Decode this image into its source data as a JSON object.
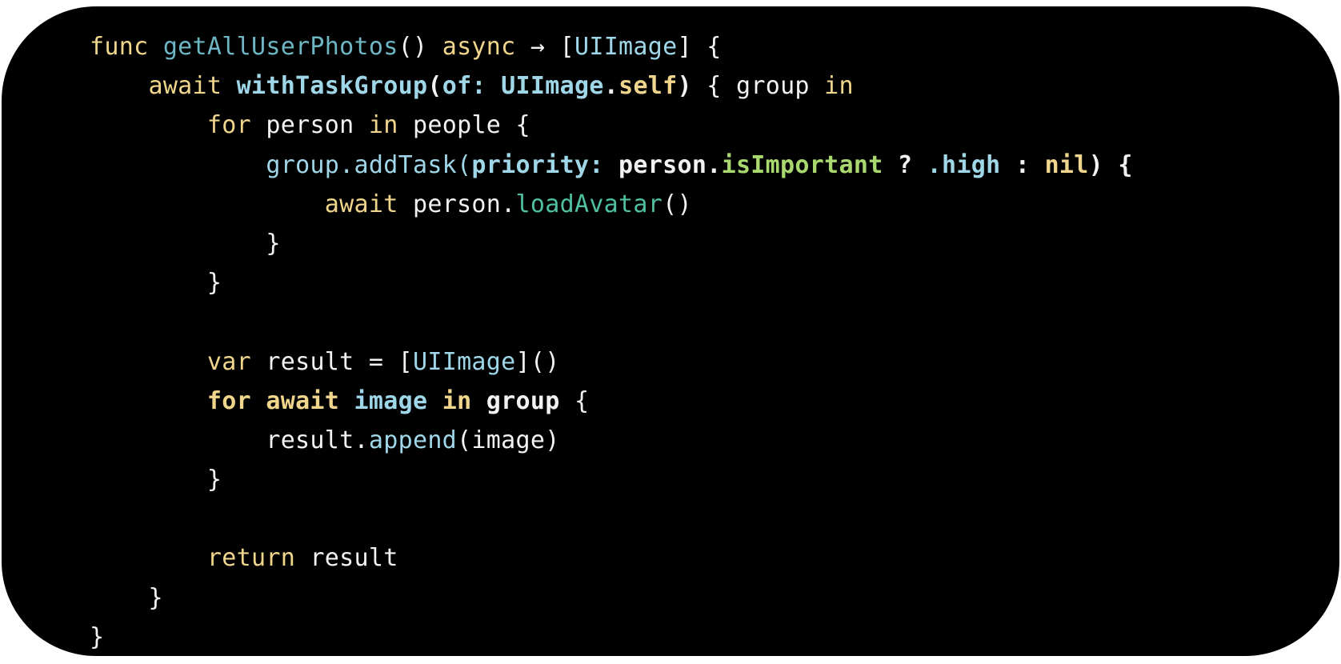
{
  "colors": {
    "background": "#000000",
    "page": "#ffffff",
    "default": "#f2f2f2",
    "keyword": "#f0d58c",
    "function": "#6fb6c4",
    "type": "#9fd6e8",
    "method_green": "#4fc0a0",
    "bright_green": "#a8d86e"
  },
  "code": {
    "language": "swift",
    "lines": [
      {
        "tokens": [
          {
            "text": "func ",
            "role": "keyword"
          },
          {
            "text": "getAllUserPhotos",
            "role": "function"
          },
          {
            "text": "() ",
            "role": "default"
          },
          {
            "text": "async",
            "role": "keyword"
          },
          {
            "text": " → [",
            "role": "default"
          },
          {
            "text": "UIImage",
            "role": "type"
          },
          {
            "text": "] {",
            "role": "default"
          }
        ]
      },
      {
        "tokens": [
          {
            "text": "    ",
            "role": "default"
          },
          {
            "text": "await ",
            "role": "keyword"
          },
          {
            "text": "withTaskGroup",
            "role": "type",
            "bold": true
          },
          {
            "text": "(",
            "role": "default",
            "bold": true
          },
          {
            "text": "of:",
            "role": "type",
            "bold": true
          },
          {
            "text": " ",
            "role": "default"
          },
          {
            "text": "UIImage",
            "role": "type",
            "bold": true
          },
          {
            "text": ".",
            "role": "default",
            "bold": true
          },
          {
            "text": "self",
            "role": "keyword",
            "bold": true
          },
          {
            "text": ")",
            "role": "default",
            "bold": true
          },
          {
            "text": " { group ",
            "role": "default"
          },
          {
            "text": "in",
            "role": "keyword"
          }
        ]
      },
      {
        "tokens": [
          {
            "text": "        ",
            "role": "default"
          },
          {
            "text": "for",
            "role": "keyword"
          },
          {
            "text": " person ",
            "role": "default"
          },
          {
            "text": "in",
            "role": "keyword"
          },
          {
            "text": " people {",
            "role": "default"
          }
        ]
      },
      {
        "tokens": [
          {
            "text": "            ",
            "role": "default"
          },
          {
            "text": "group.addTask(",
            "role": "type"
          },
          {
            "text": "priority:",
            "role": "type",
            "bold": true
          },
          {
            "text": " person.",
            "role": "default",
            "bold": true
          },
          {
            "text": "isImportant",
            "role": "bright_green",
            "bold": true
          },
          {
            "text": " ? ",
            "role": "default",
            "bold": true
          },
          {
            "text": ".high",
            "role": "type",
            "bold": true
          },
          {
            "text": " : ",
            "role": "default",
            "bold": true
          },
          {
            "text": "nil",
            "role": "keyword",
            "bold": true
          },
          {
            "text": ") {",
            "role": "default",
            "bold": true
          }
        ]
      },
      {
        "tokens": [
          {
            "text": "                ",
            "role": "default"
          },
          {
            "text": "await",
            "role": "keyword"
          },
          {
            "text": " person.",
            "role": "default"
          },
          {
            "text": "loadAvatar",
            "role": "method_green"
          },
          {
            "text": "()",
            "role": "default"
          }
        ]
      },
      {
        "tokens": [
          {
            "text": "            }",
            "role": "default"
          }
        ]
      },
      {
        "tokens": [
          {
            "text": "        }",
            "role": "default"
          }
        ]
      },
      {
        "tokens": [
          {
            "text": "",
            "role": "default"
          }
        ]
      },
      {
        "tokens": [
          {
            "text": "        ",
            "role": "default"
          },
          {
            "text": "var",
            "role": "keyword"
          },
          {
            "text": " result = [",
            "role": "default"
          },
          {
            "text": "UIImage",
            "role": "type"
          },
          {
            "text": "]()",
            "role": "default"
          }
        ]
      },
      {
        "tokens": [
          {
            "text": "        ",
            "role": "default"
          },
          {
            "text": "for await ",
            "role": "keyword",
            "bold": true
          },
          {
            "text": "image ",
            "role": "type",
            "bold": true
          },
          {
            "text": "in ",
            "role": "keyword",
            "bold": true
          },
          {
            "text": "group ",
            "role": "default",
            "bold": true
          },
          {
            "text": "{",
            "role": "default"
          }
        ]
      },
      {
        "tokens": [
          {
            "text": "            result.",
            "role": "default"
          },
          {
            "text": "append",
            "role": "type"
          },
          {
            "text": "(image)",
            "role": "default"
          }
        ]
      },
      {
        "tokens": [
          {
            "text": "        }",
            "role": "default"
          }
        ]
      },
      {
        "tokens": [
          {
            "text": "",
            "role": "default"
          }
        ]
      },
      {
        "tokens": [
          {
            "text": "        ",
            "role": "default"
          },
          {
            "text": "return",
            "role": "keyword"
          },
          {
            "text": " result",
            "role": "default"
          }
        ]
      },
      {
        "tokens": [
          {
            "text": "    }",
            "role": "default"
          }
        ]
      },
      {
        "tokens": [
          {
            "text": "}",
            "role": "default"
          }
        ]
      }
    ]
  }
}
